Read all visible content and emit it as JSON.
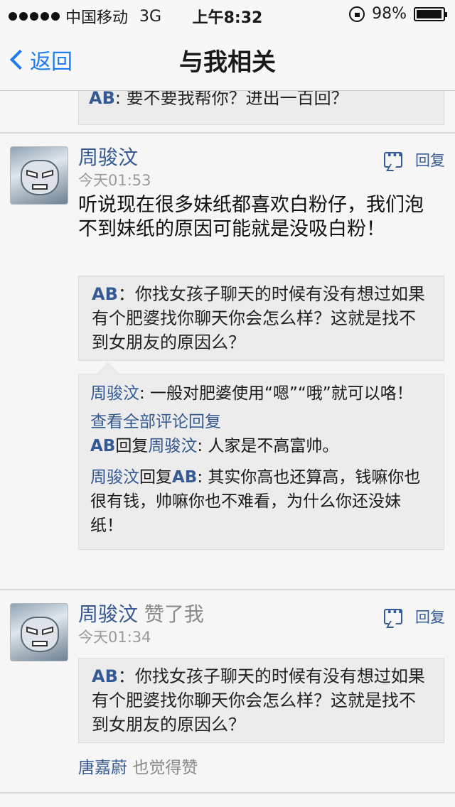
{
  "status_bar": {
    "carrier": "中国移动",
    "network": "3G",
    "time": "上午8:32",
    "battery": "98%",
    "battery_level": 0.98
  },
  "nav": {
    "back_label": "返回",
    "title": "与我相关"
  },
  "previous_item": {
    "quote_author": "AB",
    "quote_text": ": 要不要我帮你？进出一百回？"
  },
  "cards": [
    {
      "name": "周骏汶",
      "time": "今天01:53",
      "reply_label": "回复",
      "text": "听说现在很多妹纸都喜欢白粉仔，我们泡不到妹纸的原因可能就是没吸白粉！",
      "quote_author": "AB",
      "quote_text": "：你找女孩子聊天的时候有没有想过如果有个肥婆找你聊天你会怎么样？这就是找不到女朋友的原因么？",
      "comments": {
        "first": {
          "author": "周骏汶",
          "text": ": 一般对肥婆使用“嗯”“哦”就可以咯！"
        },
        "view_all": "查看全部评论回复",
        "second": {
          "author": "AB",
          "reply_word": "回复",
          "target": "周骏汶",
          "text": ": 人家是不高富帅。"
        },
        "third": {
          "author": "周骏汶",
          "reply_word": "回复",
          "target": "AB",
          "text": ": 其实你高也还算高，钱嘛你也很有钱，帅嘛你也不难看，为什么你还没妹纸！"
        }
      }
    },
    {
      "name": "周骏汶",
      "action": "赞了我",
      "time": "今天01:34",
      "reply_label": "回复",
      "quote_author": "AB",
      "quote_text": "：你找女孩子聊天的时候有没有想过如果有个肥婆找你聊天你会怎么样？这就是找不到女朋友的原因么？",
      "liker": "唐嘉蔚",
      "liker_text": "也觉得赞"
    }
  ]
}
